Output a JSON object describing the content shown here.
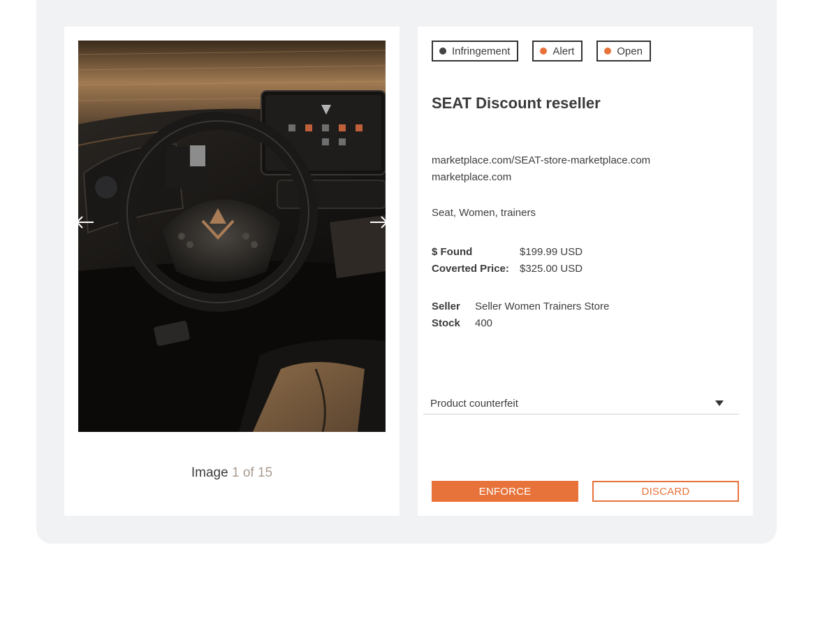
{
  "image_viewer": {
    "image_alt": "Car interior with steering wheel and dashboard display",
    "prev_icon": "arrow-left-icon",
    "next_icon": "arrow-right-icon",
    "counter_label": "Image",
    "counter_current": "1",
    "counter_of": "of",
    "counter_total": "15"
  },
  "tags": [
    {
      "label": "Infringement",
      "dot_color": "#444444"
    },
    {
      "label": "Alert",
      "dot_color": "#e8733a"
    },
    {
      "label": "Open",
      "dot_color": "#e8733a"
    }
  ],
  "listing": {
    "title": "SEAT Discount reseller",
    "url": "marketplace.com/SEAT-store-marketplace.com",
    "domain": "marketplace.com",
    "keywords": "Seat, Women, trainers",
    "found_label": "$ Found",
    "found_value": "$199.99 USD",
    "converted_label": "Coverted Price:",
    "converted_value": "$325.00 USD",
    "seller_label": "Seller",
    "seller_value": "Seller Women Trainers Store",
    "stock_label": "Stock",
    "stock_value": "400"
  },
  "reason_select": {
    "value": "Product counterfeit"
  },
  "actions": {
    "enforce_label": "ENFORCE",
    "discard_label": "DISCARD"
  },
  "colors": {
    "accent": "#e8733a",
    "frame_bg": "#f1f2f4"
  }
}
